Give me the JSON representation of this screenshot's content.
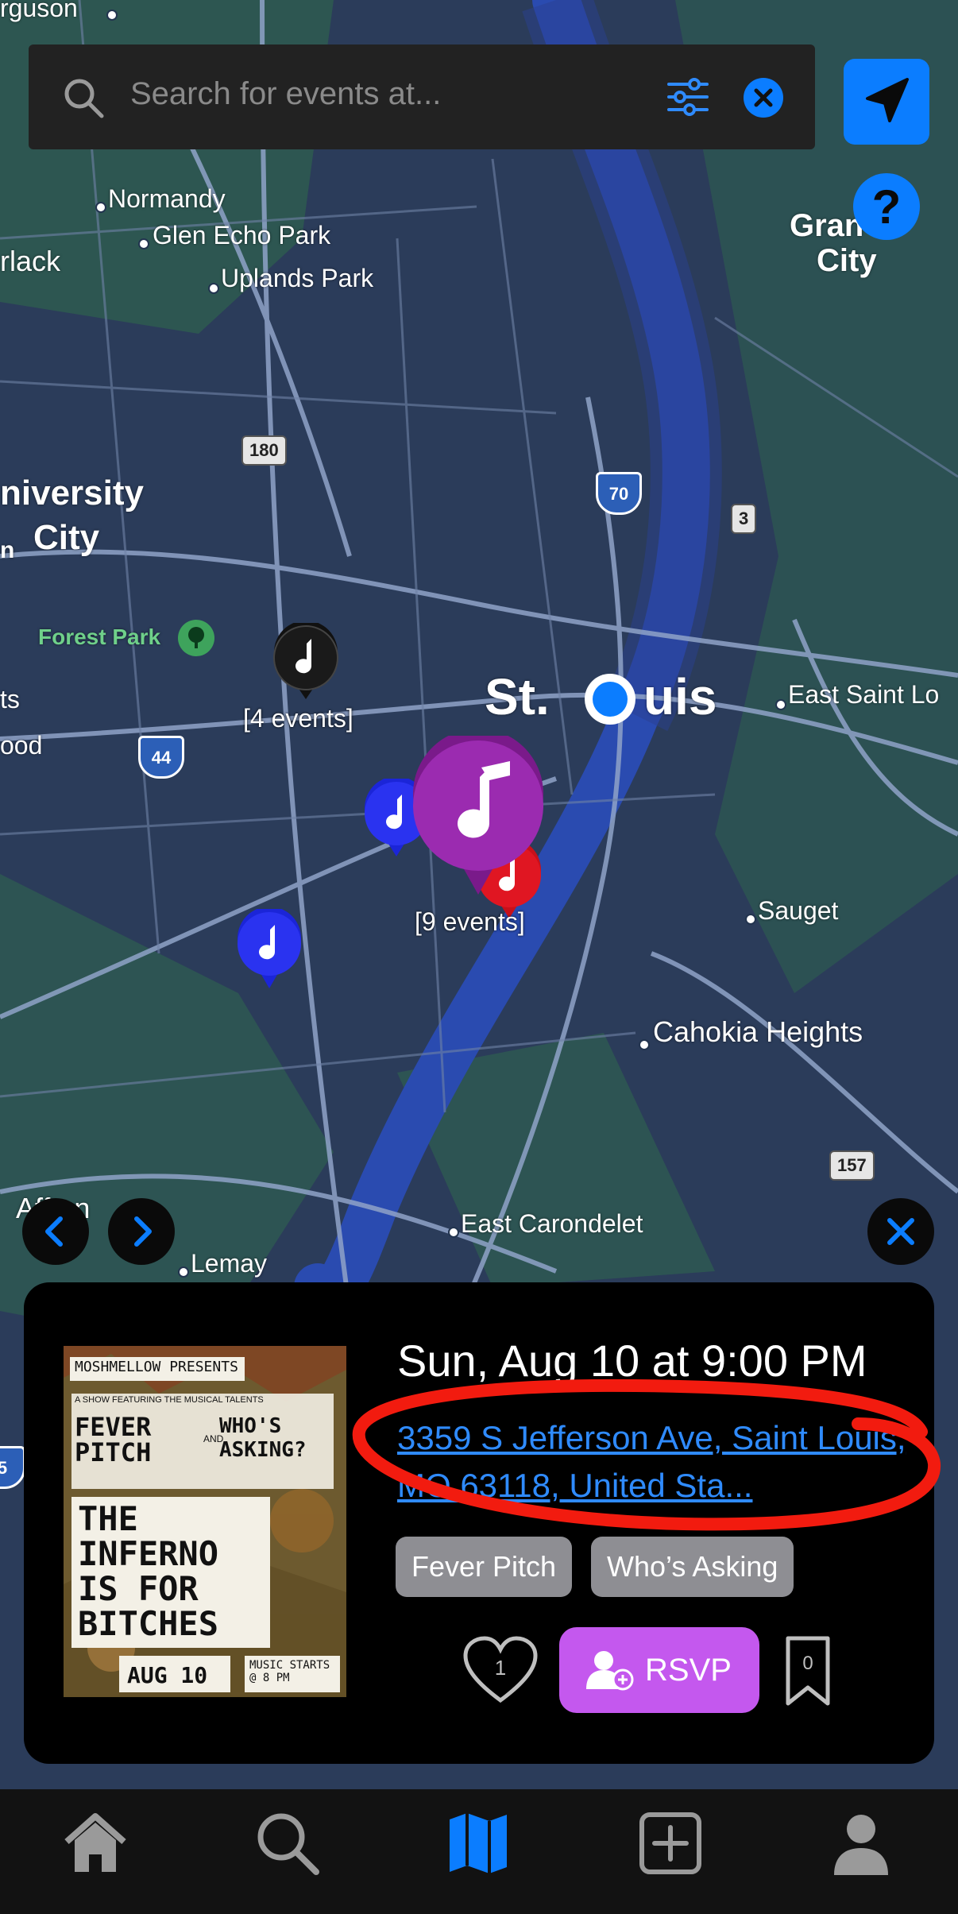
{
  "map": {
    "places": {
      "ferguson": "rguson",
      "normandy": "Normandy",
      "glen_echo_park": "Glen Echo Park",
      "uplands_park": "Uplands Park",
      "overland": "rlack",
      "university_city_1": "niversity",
      "university_city_2": "City",
      "university_city_prefix": "n",
      "granite_city_1": "Gran",
      "granite_city_2": "City",
      "forest_park": "Forest Park",
      "st_louis_1": "St.",
      "st_louis_2": "uis",
      "east_saint_louis": "East Saint Lo",
      "sauget": "Sauget",
      "cahokia_heights": "Cahokia Heights",
      "east_carondelet": "East Carondelet",
      "lemay": "Lemay",
      "affton": "Affton",
      "left_ts": "ts",
      "left_ood": "ood"
    },
    "road_shields": {
      "mo180": "180",
      "i70": "70",
      "il3": "3",
      "i44": "44",
      "il157": "157",
      "i55": "5"
    },
    "pins": {
      "cluster_a_label": "[4 events]",
      "cluster_b_label": "[9 events]"
    },
    "colors": {
      "water": "#2a4bb0",
      "land": "#2b3c5a",
      "park": "#2f6b4b",
      "road": "#8fa3c8"
    }
  },
  "search": {
    "placeholder": "Search for events at...",
    "icons": [
      "search-icon",
      "filter-icon",
      "clear-icon"
    ]
  },
  "help_label": "?",
  "event_card": {
    "date": "Sun, Aug 10 at 9:00 PM",
    "address": "3359 S Jefferson Ave, Saint Louis, MO  63118, United Sta...",
    "tags": [
      "Fever Pitch",
      "Who’s Asking"
    ],
    "like_count": "1",
    "rsvp_label": "RSVP",
    "bookmark_count": "0",
    "poster": {
      "line1": "MOSHMELLOW PRESENTS",
      "line2": "A SHOW FEATURING THE MUSICAL TALENTS",
      "band1": "FEVER PITCH",
      "and": "AND",
      "band2": "WHO'S ASKING?",
      "title": "THE INFERNO IS FOR BITCHES",
      "date": "AUG 10",
      "time": "MUSIC STARTS @ 8 PM"
    }
  },
  "tabbar": {
    "items": [
      "home-icon",
      "search-icon",
      "map-icon",
      "add-icon",
      "profile-icon"
    ],
    "active_color": "#0b7dff"
  }
}
